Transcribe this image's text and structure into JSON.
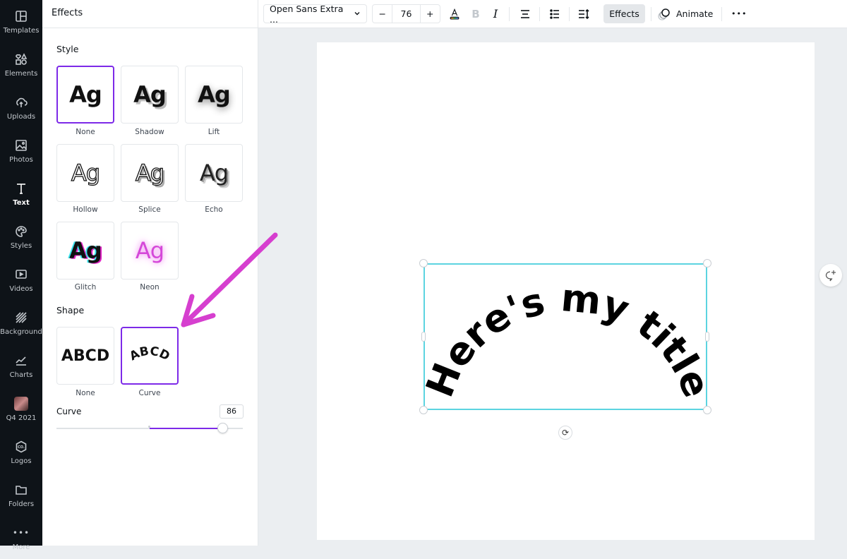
{
  "rail": {
    "items": [
      {
        "label": "Templates",
        "icon": "templates-icon"
      },
      {
        "label": "Elements",
        "icon": "elements-icon"
      },
      {
        "label": "Uploads",
        "icon": "upload-cloud-icon"
      },
      {
        "label": "Photos",
        "icon": "photo-icon"
      },
      {
        "label": "Text",
        "icon": "text-icon",
        "active": true
      },
      {
        "label": "Styles",
        "icon": "palette-icon"
      },
      {
        "label": "Videos",
        "icon": "video-icon"
      },
      {
        "label": "Background",
        "icon": "background-icon"
      },
      {
        "label": "Charts",
        "icon": "chart-icon"
      },
      {
        "label": "Q4 2021",
        "icon": "folder-thumbnail"
      },
      {
        "label": "Logos",
        "icon": "logo-icon"
      },
      {
        "label": "Folders",
        "icon": "folder-icon"
      },
      {
        "label": "More",
        "icon": "more-icon"
      }
    ]
  },
  "panel": {
    "title": "Effects",
    "style_section": "Style",
    "styles": [
      {
        "label": "None",
        "preview": "Ag",
        "selected": true
      },
      {
        "label": "Shadow",
        "preview": "Ag"
      },
      {
        "label": "Lift",
        "preview": "Ag"
      },
      {
        "label": "Hollow",
        "preview": "Ag"
      },
      {
        "label": "Splice",
        "preview": "Ag"
      },
      {
        "label": "Echo",
        "preview": "Ag"
      },
      {
        "label": "Glitch",
        "preview": "Ag"
      },
      {
        "label": "Neon",
        "preview": "Ag"
      }
    ],
    "shape_section": "Shape",
    "shapes": [
      {
        "label": "None",
        "preview": "ABCD"
      },
      {
        "label": "Curve",
        "preview": "ABCD",
        "selected": true
      }
    ],
    "curve_label": "Curve",
    "curve_value": "86",
    "curve_percent": 86
  },
  "toolbar": {
    "font": "Open Sans Extra ...",
    "font_size": "76",
    "minus": "−",
    "plus": "+",
    "effects_label": "Effects",
    "animate_label": "Animate",
    "more": "•••"
  },
  "canvas": {
    "text": "Here's my title"
  },
  "colors": {
    "accent": "#7d2ae8",
    "selection": "#5cd4e0",
    "annotation_arrow": "#d63fcf"
  }
}
